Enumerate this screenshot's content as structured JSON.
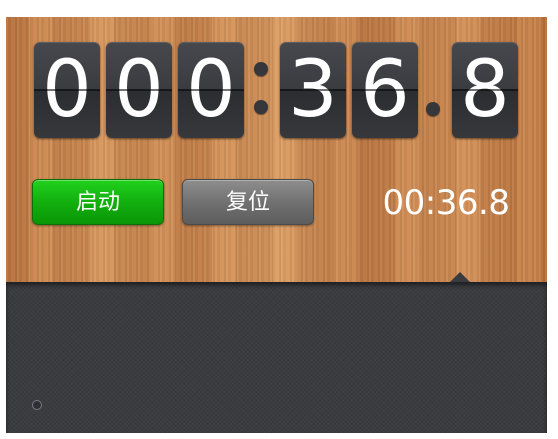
{
  "timer": {
    "digits": [
      "0",
      "0",
      "0",
      "3",
      "6",
      "8"
    ],
    "separator_colon": ":",
    "separator_dot": "."
  },
  "controls": {
    "start_label": "启动",
    "reset_label": "复位"
  },
  "readout": {
    "elapsed_text": "00:36.8"
  },
  "colors": {
    "start_button": "#12b00e",
    "reset_button": "#717171",
    "digit_tile": "#3a3c40",
    "panel_dark": "#3b3c40"
  }
}
